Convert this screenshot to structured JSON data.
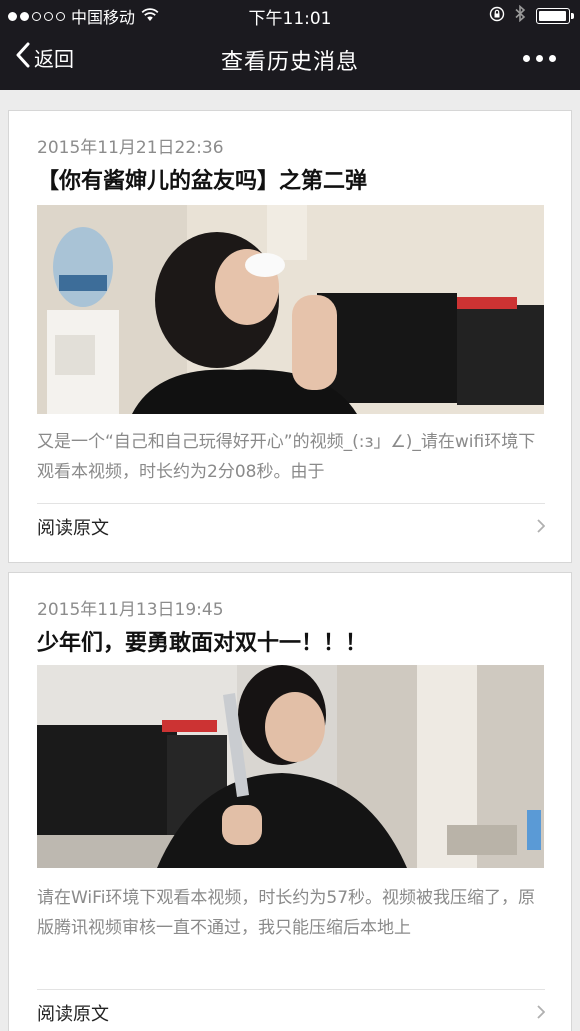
{
  "status_bar": {
    "carrier": "中国移动",
    "time": "下午11:01",
    "battery_percent": 95
  },
  "nav": {
    "back_label": "返回",
    "title": "查看历史消息"
  },
  "posts": [
    {
      "date": "2015年11月21日22:36",
      "title": "【你有酱婶儿的盆友吗】之第二弹",
      "description": "又是一个“自己和自己玩得好开心”的视频_(:з」∠)_请在wifi环境下观看本视频，时长约为2分08秒。由于",
      "read_more": "阅读原文"
    },
    {
      "date": "2015年11月13日19:45",
      "title": "少年们，要勇敢面对双十一！！！",
      "description": "请在WiFi环境下观看本视频，时长约为57秒。视频被我压缩了，原版腾讯视频审核一直不通过，我只能压缩后本地上",
      "read_more": "阅读原文"
    }
  ],
  "colors": {
    "bar": "#1b1a1f",
    "background": "#ececec",
    "date_text": "#8c8c8c",
    "desc_text": "#8a8a8a"
  },
  "icons": {
    "back": "chevron-left-icon",
    "more": "more-dots-icon",
    "wifi": "wifi-icon",
    "lock_rotation": "rotation-lock-icon",
    "bluetooth": "bluetooth-icon",
    "battery": "battery-icon",
    "chevron": "chevron-right-icon"
  }
}
